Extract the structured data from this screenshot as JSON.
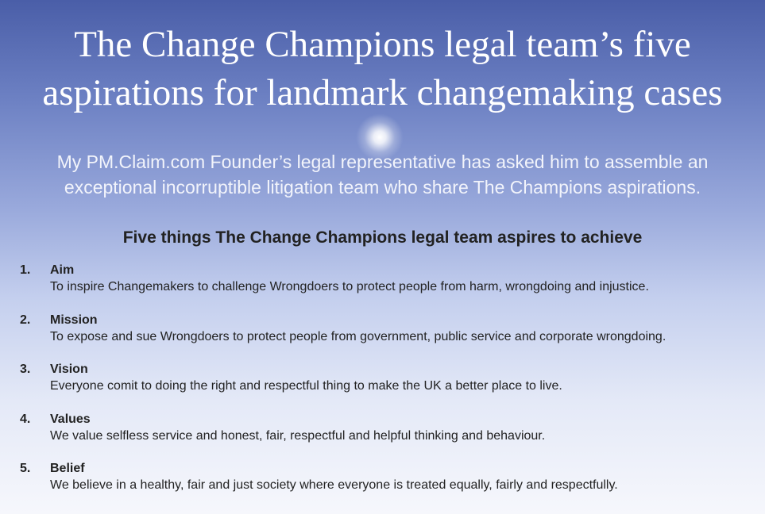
{
  "title": {
    "line1": "The Change Champions legal team’s five",
    "line2": "aspirations for landmark changemaking cases"
  },
  "subtitle": {
    "line1": "My PM.Claim.com Founder’s legal representative has asked him to assemble an",
    "line2": "exceptional incorruptible litigation team who share The Champions aspirations."
  },
  "list_heading": "Five things The Change Champions legal team aspires to achieve",
  "aspirations": [
    {
      "number": "1.",
      "label": "Aim",
      "text": "To inspire Changemakers to challenge Wrongdoers to protect people from harm, wrongdoing and injustice."
    },
    {
      "number": "2.",
      "label": "Mission",
      "text": "To expose and sue Wrongdoers to protect people from government, public service and corporate wrongdoing."
    },
    {
      "number": "3.",
      "label": "Vision",
      "text": "Everyone comit to doing the right and respectful thing to make the UK a better place to live."
    },
    {
      "number": "4.",
      "label": "Values",
      "text": "We value selfless service and honest, fair, respectful and helpful thinking and behaviour."
    },
    {
      "number": "5.",
      "label": "Belief",
      "text": "We believe in a healthy, fair and just society where everyone is treated equally, fairly and respectfully."
    }
  ]
}
